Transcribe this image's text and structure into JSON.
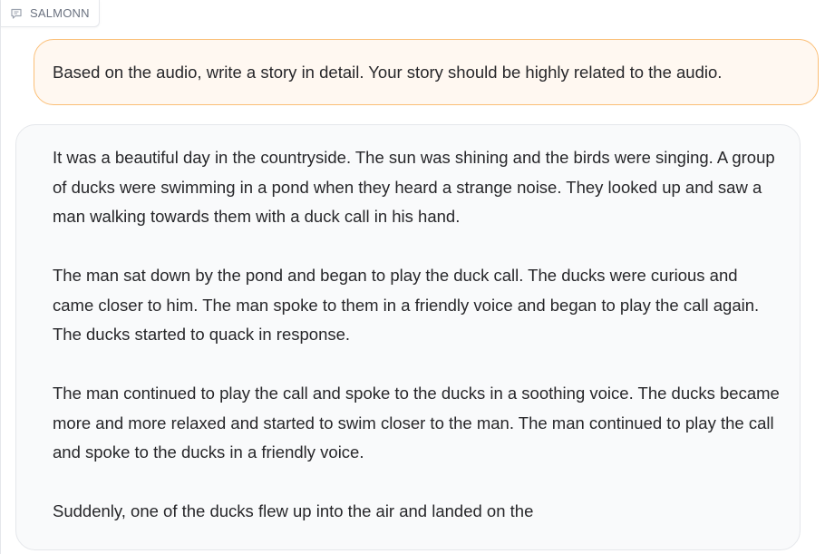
{
  "chatbot": {
    "label": "SALMONN",
    "label_icon": "chat-bubble-icon"
  },
  "messages": {
    "user": "Based on the audio, write a story in detail. Your story should be highly related to the audio.",
    "bot_paragraphs": [
      "It was a beautiful day in the countryside. The sun was shining and the birds were singing. A group of ducks were swimming in a pond when they heard a strange noise. They looked up and saw a man walking towards them with a duck call in his hand.",
      "The man sat down by the pond and began to play the duck call. The ducks were curious and came closer to him. The man spoke to them in a friendly voice and began to play the call again. The ducks started to quack in response.",
      "The man continued to play the call and spoke to the ducks in a soothing voice. The ducks became more and more relaxed and started to swim closer to the man. The man continued to play the call and spoke to the ducks in a friendly voice.",
      "Suddenly, one of the ducks flew up into the air and landed on the"
    ]
  },
  "colors": {
    "user_bubble_bg": "#fff8f1",
    "user_bubble_border": "#fbbf77",
    "bot_bubble_bg": "#f9fafb"
  }
}
